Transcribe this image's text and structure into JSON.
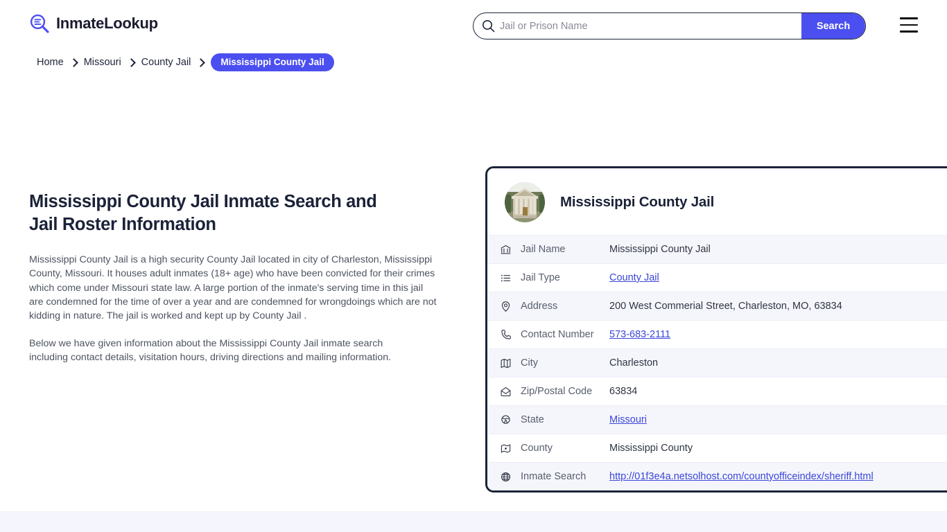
{
  "header": {
    "logo_text": "InmateLookup",
    "logo_icon": "magnifier-list-icon",
    "menu_icon": "hamburger-menu-icon"
  },
  "search": {
    "icon": "search-icon",
    "placeholder": "Jail or Prison Name",
    "value": "",
    "button_label": "Search"
  },
  "breadcrumb": {
    "items": [
      {
        "label": "Home"
      },
      {
        "label": "Missouri"
      },
      {
        "label": "County Jail"
      }
    ],
    "current": "Mississippi County Jail"
  },
  "content": {
    "title": "Mississippi County Jail Inmate Search and Jail Roster Information",
    "paragraph1": "Mississippi County Jail is a high security County Jail located in city of Charleston, Mississippi County, Missouri. It houses adult inmates (18+ age) who have been convicted for their crimes which come under Missouri state law. A large portion of the inmate's serving time in this jail are condemned for the time of over a year and are condemned for wrongdoings which are not kidding in nature. The jail is worked and kept up by County Jail .",
    "paragraph2": "Below we have given information about the Mississippi County Jail inmate search including contact details, visitation hours, driving directions and mailing information."
  },
  "card": {
    "thumbnail_alt": "courthouse-photo",
    "title": "Mississippi County Jail",
    "rows": [
      {
        "icon": "bank-icon",
        "label": "Jail Name",
        "value": "Mississippi County Jail",
        "is_link": false
      },
      {
        "icon": "list-icon",
        "label": "Jail Type",
        "value": "County Jail",
        "is_link": true
      },
      {
        "icon": "map-pin-icon",
        "label": "Address",
        "value": "200 West Commerial Street, Charleston, MO, 63834",
        "is_link": false
      },
      {
        "icon": "phone-icon",
        "label": "Contact Number",
        "value": "573-683-2111",
        "is_link": true
      },
      {
        "icon": "map-icon",
        "label": "City",
        "value": "Charleston",
        "is_link": false
      },
      {
        "icon": "mail-open-icon",
        "label": "Zip/Postal Code",
        "value": "63834",
        "is_link": false
      },
      {
        "icon": "globe-stand-icon",
        "label": "State",
        "value": "Missouri",
        "is_link": true
      },
      {
        "icon": "map-dot-icon",
        "label": "County",
        "value": "Mississippi County",
        "is_link": false
      },
      {
        "icon": "globe-icon",
        "label": "Inmate Search",
        "value": "http://01f3e4a.netsolhost.com/countyofficeindex/sheriff.html",
        "is_link": true
      }
    ]
  },
  "colors": {
    "accent_blue": "#4b4ff0",
    "link_blue": "#3b46d8",
    "dark_navy": "#1b2338",
    "row_alt_bg": "#f5f6fc",
    "footer_bg": "#f4f5fd"
  }
}
